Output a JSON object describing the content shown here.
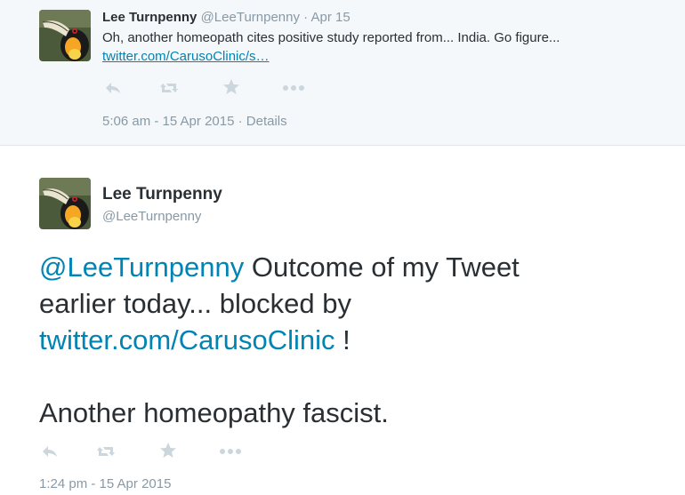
{
  "top_tweet": {
    "name": "Lee Turnpenny",
    "handle": "@LeeTurnpenny",
    "separator": "·",
    "date": "Apr 15",
    "text": "Oh, another homeopath cites positive study reported from... India. Go figure...",
    "link": "twitter.com/CarusoClinic/s…",
    "timestamp": "5:06 am - 15 Apr 2015",
    "meta_separator": "·",
    "details_label": "Details",
    "actions": [
      "reply-icon",
      "retweet-icon",
      "favorite-icon",
      "more-icon"
    ]
  },
  "main_tweet": {
    "name": "Lee Turnpenny",
    "handle": "@LeeTurnpenny",
    "mention": "@LeeTurnpenny",
    "line1_rest": " Outcome of my Tweet",
    "line2": "earlier today... blocked by",
    "link": "twitter.com/CarusoClinic",
    "link_suffix": " !",
    "line4": "Another homeopathy fascist.",
    "timestamp": "1:24 pm - 15 Apr 2015",
    "actions": [
      "reply-icon",
      "retweet-icon",
      "favorite-icon",
      "more-icon"
    ]
  },
  "colors": {
    "link": "#0084b4",
    "muted": "#8899a6",
    "text": "#292f33",
    "top_background": "#f5f8fa"
  }
}
